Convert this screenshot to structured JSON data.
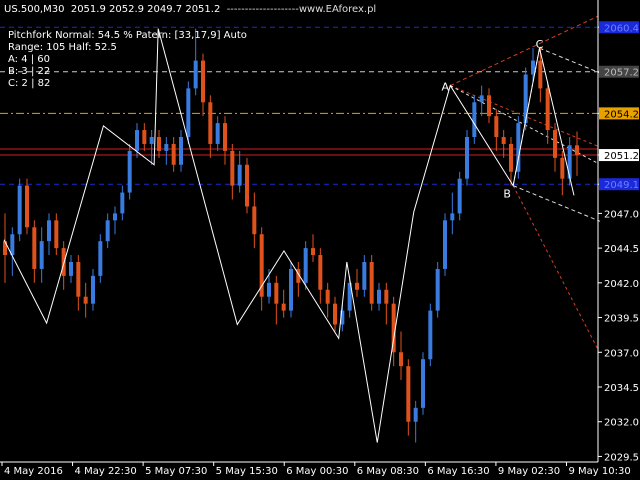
{
  "header": {
    "symbol": "US.500,M30",
    "ohlc": "2051.9 2052.9 2049.7 2051.2",
    "watermark": "www.EAforex.pl"
  },
  "info": {
    "pitchfork": "Pitchfork Normal: 54.5 % Patern: [33,17,9] Auto",
    "range": "Range: 105 Half: 52.5",
    "a": "A:   4 | 60",
    "b": "B:   3 | 22",
    "c": "C:   2 | 82"
  },
  "colors": {
    "background": "#000000",
    "bull": "#3a7be0",
    "bear": "#e0521c",
    "zigzag": "#ffffff",
    "level_blue": "#1a2ad8",
    "level_orange": "#e8a200",
    "level_red": "#d02020",
    "level_gray": "#cccccc",
    "fork_red": "#d04020",
    "fork_white": "#dddddd"
  },
  "chart_data": {
    "type": "candlestick",
    "ylim": [
      2029.1,
      2061.5
    ],
    "y_ticks": [
      "2060.4",
      "2057.2",
      "2054.2",
      "2051.2",
      "2049.1",
      "2047.0",
      "2044.5",
      "2042.0",
      "2039.5",
      "2037.0",
      "2034.5",
      "2032.0",
      "2029.5"
    ],
    "x_ticks": [
      "4 May 2016",
      "4 May 22:30",
      "5 May 07:30",
      "5 May 15:30",
      "6 May 00:30",
      "6 May 08:30",
      "6 May 16:30",
      "9 May 02:30",
      "9 May 10:30"
    ],
    "price_levels": [
      {
        "price": 2060.4,
        "label": "2060.4",
        "color": "blue"
      },
      {
        "price": 2057.2,
        "label": "2057.2",
        "color": "gray"
      },
      {
        "price": 2054.2,
        "label": "2054.2",
        "color": "orange"
      },
      {
        "price": 2051.2,
        "label": "2051.2",
        "color": "red"
      },
      {
        "price": 2049.1,
        "label": "2049.1",
        "color": "blue"
      }
    ],
    "pattern_labels": [
      "A",
      "B",
      "C"
    ],
    "zigzag": [
      [
        1,
        2045.1
      ],
      [
        22,
        2039.1
      ],
      [
        50,
        2053.3
      ],
      [
        75,
        2050.5
      ],
      [
        77,
        2060.3
      ],
      [
        116,
        2039.0
      ],
      [
        139,
        2044.3
      ],
      [
        166,
        2038.0
      ],
      [
        170,
        2043.5
      ],
      [
        185,
        2030.5
      ],
      [
        203,
        2047.1
      ],
      [
        221,
        2056.2
      ],
      [
        252,
        2049.0
      ],
      [
        265,
        2058.9
      ],
      [
        282,
        2048.3
      ]
    ],
    "candles": [
      [
        2045.0,
        2047.0,
        2042.0,
        2044.0
      ],
      [
        2044.0,
        2046.0,
        2042.5,
        2045.5
      ],
      [
        2045.5,
        2049.5,
        2045.0,
        2049.0
      ],
      [
        2049.0,
        2049.5,
        2045.5,
        2046.0
      ],
      [
        2046.0,
        2046.5,
        2042.0,
        2043.0
      ],
      [
        2043.0,
        2046.0,
        2042.0,
        2045.0
      ],
      [
        2045.0,
        2047.0,
        2044.0,
        2046.5
      ],
      [
        2046.5,
        2047.0,
        2044.0,
        2044.5
      ],
      [
        2044.5,
        2045.0,
        2041.5,
        2042.5
      ],
      [
        2042.5,
        2044.0,
        2042.0,
        2043.5
      ],
      [
        2043.5,
        2044.0,
        2040.0,
        2041.0
      ],
      [
        2041.0,
        2042.0,
        2039.5,
        2040.5
      ],
      [
        2040.5,
        2043.0,
        2040.0,
        2042.5
      ],
      [
        2042.5,
        2045.5,
        2042.0,
        2045.0
      ],
      [
        2045.0,
        2047.0,
        2044.5,
        2046.5
      ],
      [
        2046.5,
        2047.5,
        2045.5,
        2047.0
      ],
      [
        2047.0,
        2049.0,
        2046.5,
        2048.5
      ],
      [
        2048.5,
        2052.0,
        2048.0,
        2051.5
      ],
      [
        2051.5,
        2053.5,
        2051.0,
        2053.0
      ],
      [
        2053.0,
        2053.5,
        2051.5,
        2052.0
      ],
      [
        2052.0,
        2053.0,
        2050.5,
        2052.5
      ],
      [
        2052.5,
        2053.0,
        2051.0,
        2051.5
      ],
      [
        2051.5,
        2052.5,
        2050.5,
        2052.0
      ],
      [
        2052.0,
        2052.5,
        2050.0,
        2050.5
      ],
      [
        2050.5,
        2053.0,
        2050.0,
        2052.5
      ],
      [
        2052.5,
        2056.5,
        2052.0,
        2056.0
      ],
      [
        2056.0,
        2060.3,
        2055.5,
        2058.0
      ],
      [
        2058.0,
        2058.5,
        2054.0,
        2055.0
      ],
      [
        2055.0,
        2055.5,
        2051.0,
        2052.0
      ],
      [
        2052.0,
        2054.0,
        2051.5,
        2053.5
      ],
      [
        2053.5,
        2054.0,
        2050.5,
        2051.5
      ],
      [
        2051.5,
        2052.0,
        2048.0,
        2049.0
      ],
      [
        2049.0,
        2051.5,
        2048.5,
        2050.5
      ],
      [
        2050.5,
        2051.0,
        2047.0,
        2047.5
      ],
      [
        2047.5,
        2048.5,
        2044.5,
        2045.5
      ],
      [
        2045.5,
        2046.0,
        2040.0,
        2041.0
      ],
      [
        2041.0,
        2043.0,
        2040.5,
        2042.0
      ],
      [
        2042.0,
        2042.5,
        2039.0,
        2040.5
      ],
      [
        2040.5,
        2041.5,
        2039.5,
        2040.0
      ],
      [
        2040.0,
        2043.5,
        2039.5,
        2043.0
      ],
      [
        2043.0,
        2043.5,
        2041.0,
        2042.0
      ],
      [
        2042.0,
        2045.0,
        2041.5,
        2044.5
      ],
      [
        2044.5,
        2045.5,
        2043.5,
        2044.0
      ],
      [
        2044.0,
        2044.5,
        2040.5,
        2041.5
      ],
      [
        2041.5,
        2042.0,
        2039.5,
        2040.5
      ],
      [
        2040.5,
        2041.0,
        2038.5,
        2039.0
      ],
      [
        2039.0,
        2040.5,
        2038.5,
        2040.0
      ],
      [
        2040.0,
        2042.5,
        2039.5,
        2042.0
      ],
      [
        2042.0,
        2043.0,
        2041.0,
        2041.5
      ],
      [
        2041.5,
        2044.0,
        2041.0,
        2043.5
      ],
      [
        2043.5,
        2044.0,
        2040.0,
        2040.5
      ],
      [
        2040.5,
        2042.0,
        2040.0,
        2041.5
      ],
      [
        2041.5,
        2042.0,
        2039.0,
        2040.5
      ],
      [
        2040.5,
        2041.0,
        2036.0,
        2037.0
      ],
      [
        2037.0,
        2038.5,
        2035.0,
        2036.0
      ],
      [
        2036.0,
        2036.5,
        2031.0,
        2032.0
      ],
      [
        2032.0,
        2033.5,
        2030.5,
        2033.0
      ],
      [
        2033.0,
        2037.0,
        2032.5,
        2036.5
      ],
      [
        2036.5,
        2040.5,
        2036.0,
        2040.0
      ],
      [
        2040.0,
        2043.5,
        2039.5,
        2043.0
      ],
      [
        2043.0,
        2047.0,
        2042.5,
        2046.5
      ],
      [
        2046.5,
        2048.5,
        2045.5,
        2047.0
      ],
      [
        2047.0,
        2050.0,
        2046.5,
        2049.5
      ],
      [
        2049.5,
        2053.0,
        2049.0,
        2052.5
      ],
      [
        2052.5,
        2055.5,
        2052.0,
        2055.0
      ],
      [
        2055.0,
        2056.2,
        2054.0,
        2055.5
      ],
      [
        2055.5,
        2056.0,
        2053.5,
        2054.0
      ],
      [
        2054.0,
        2054.5,
        2051.5,
        2052.5
      ],
      [
        2052.5,
        2053.0,
        2051.0,
        2052.0
      ],
      [
        2052.0,
        2052.5,
        2049.0,
        2050.0
      ],
      [
        2050.0,
        2054.0,
        2049.5,
        2053.5
      ],
      [
        2053.5,
        2057.5,
        2053.0,
        2057.0
      ],
      [
        2057.0,
        2058.9,
        2056.5,
        2058.0
      ],
      [
        2058.0,
        2059.0,
        2055.0,
        2056.0
      ],
      [
        2056.0,
        2056.5,
        2052.0,
        2053.0
      ],
      [
        2053.0,
        2053.5,
        2050.0,
        2051.0
      ],
      [
        2051.0,
        2051.5,
        2048.3,
        2049.5
      ],
      [
        2049.5,
        2052.5,
        2049.0,
        2051.9
      ],
      [
        2051.9,
        2052.9,
        2049.7,
        2051.2
      ]
    ]
  }
}
